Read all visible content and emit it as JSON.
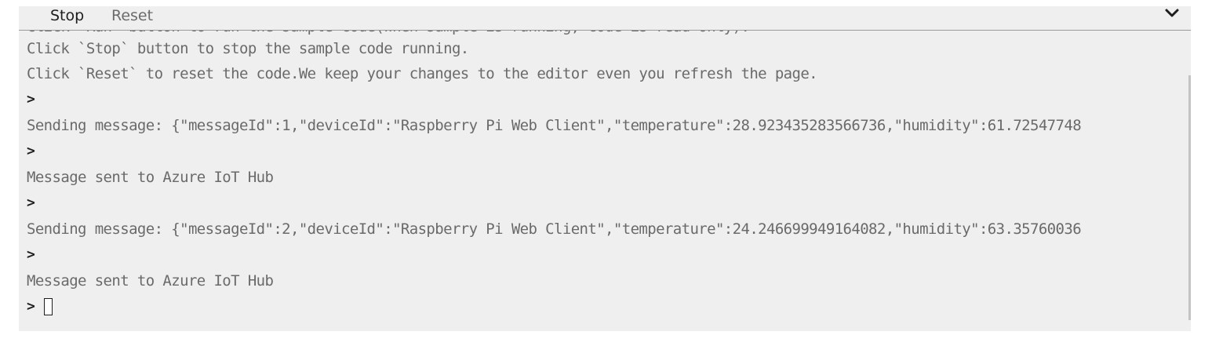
{
  "toolbar": {
    "stop_label": "Stop",
    "reset_label": "Reset",
    "collapse_icon": "chevron-down-icon"
  },
  "console": {
    "partial_line": "Click `Run` button to run the sample code(When sample is running, code is read-only).",
    "lines": [
      "Click `Stop` button to stop the sample code running.",
      "Click `Reset` to reset the code.We keep your changes to the editor even you refresh the page.",
      "Sending message: {\"messageId\":1,\"deviceId\":\"Raspberry Pi Web Client\",\"temperature\":28.923435283566736,\"humidity\":61.72547748",
      "Message sent to Azure IoT Hub",
      "Sending message: {\"messageId\":2,\"deviceId\":\"Raspberry Pi Web Client\",\"temperature\":24.246699949164082,\"humidity\":63.35760036",
      "Message sent to Azure IoT Hub"
    ],
    "prompt_symbol": ">"
  }
}
